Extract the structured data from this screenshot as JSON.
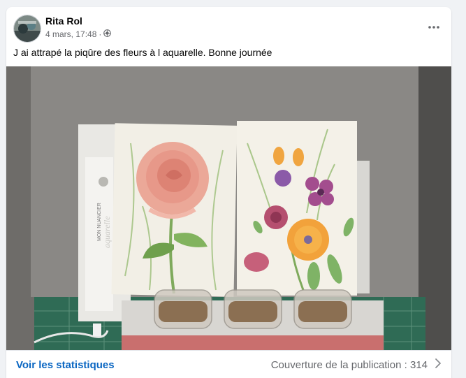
{
  "post": {
    "author": "Rita Rol",
    "timestamp": "4 mars, 17:48",
    "separator": "·",
    "audience_icon": "globe-icon",
    "text": "J ai attrapé la piqûre des fleurs à l aquarelle.  Bonne journée",
    "more_icon": "more-options-icon"
  },
  "photo": {
    "artwork_box_text": [
      "MON NUANCIER",
      "aquarelle"
    ]
  },
  "footer": {
    "stats_label": "Voir les statistiques",
    "reach_label": "Couverture de la publication : 314",
    "reach_icon": "chevron-right-icon"
  },
  "colors": {
    "link": "#0a66c2",
    "secondary_text": "#65676b"
  }
}
